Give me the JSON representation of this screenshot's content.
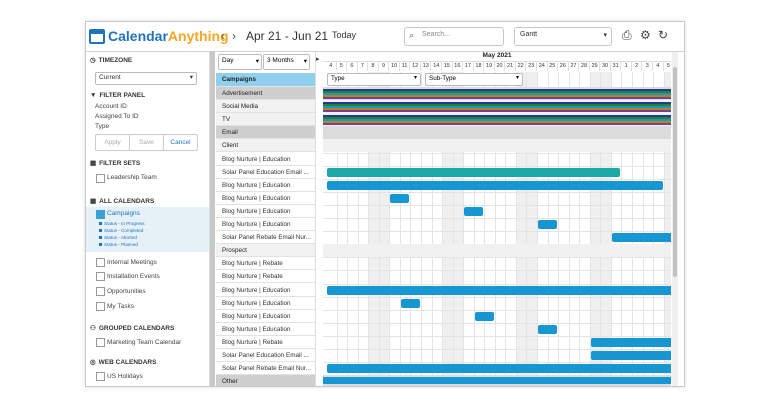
{
  "app": {
    "logo_part1": "Calendar",
    "logo_part2": "Anything"
  },
  "toolbar": {
    "prev": "‹",
    "next": "›",
    "date_range": "Apr 21 - Jun 21",
    "today": "Today",
    "search_placeholder": "Search...",
    "view": "Gantt",
    "print_icon": "printer-icon",
    "settings_icon": "gear-icon",
    "refresh_icon": "refresh-icon"
  },
  "sidebar": {
    "timezone": {
      "title": "TIMEZONE",
      "value": "Current"
    },
    "filter_panel": {
      "title": "FILTER PANEL",
      "fields": [
        "Account ID",
        "Assigned To ID",
        "Type"
      ],
      "apply": "Apply",
      "save": "Save",
      "cancel": "Cancel"
    },
    "filter_sets": {
      "title": "FILTER SETS",
      "items": [
        "Leadership Team"
      ]
    },
    "all_calendars": {
      "title": "ALL CALENDARS",
      "items": [
        "Campaigns",
        "Internal Meetings",
        "Installation Events",
        "Opportunities",
        "My Tasks"
      ],
      "legend": [
        "Status - In Progress",
        "Status - Completed",
        "Status - Aborted",
        "Status - Planned"
      ]
    },
    "grouped_calendars": {
      "title": "GROUPED CALENDARS",
      "items": [
        "Marketing Team Calendar"
      ]
    },
    "web_calendars": {
      "title": "WEB CALENDARS",
      "items": [
        "US Holidays"
      ]
    }
  },
  "gantt": {
    "scale": "Day",
    "span": "3 Months",
    "header": "Campaigns",
    "month": "May 2021",
    "days": [
      "4",
      "5",
      "6",
      "7",
      "8",
      "9",
      "10",
      "11",
      "12",
      "13",
      "14",
      "15",
      "16",
      "17",
      "18",
      "19",
      "20",
      "21",
      "22",
      "23",
      "24",
      "25",
      "26",
      "27",
      "28",
      "29",
      "30",
      "31",
      "1",
      "2",
      "3",
      "4",
      "5"
    ],
    "filter_type": "Type",
    "filter_subtype": "Sub-Type",
    "rows": [
      {
        "label": "Advertisement",
        "kind": "grp"
      },
      {
        "label": "Social Media",
        "kind": "sub"
      },
      {
        "label": "TV",
        "kind": "sub"
      },
      {
        "label": "Email",
        "kind": "grp"
      },
      {
        "label": "Client",
        "kind": "sub"
      },
      {
        "label": "Blog Nurture | Education",
        "kind": "item"
      },
      {
        "label": "Solar Panel Education Email ...",
        "kind": "item"
      },
      {
        "label": "Blog Nurture | Education",
        "kind": "item"
      },
      {
        "label": "Blog Nurture | Education",
        "kind": "item"
      },
      {
        "label": "Blog Nurture | Education",
        "kind": "item"
      },
      {
        "label": "Blog Nurture | Education",
        "kind": "item"
      },
      {
        "label": "Solar Panel Rebate Email Nur...",
        "kind": "item"
      },
      {
        "label": "Prospect",
        "kind": "sub"
      },
      {
        "label": "Blog Nurture | Rebate",
        "kind": "item"
      },
      {
        "label": "Blog Nurture | Rebate",
        "kind": "item"
      },
      {
        "label": "Blog Nurture | Education",
        "kind": "item"
      },
      {
        "label": "Blog Nurture | Education",
        "kind": "item"
      },
      {
        "label": "Blog Nurture | Education",
        "kind": "item"
      },
      {
        "label": "Blog Nurture | Education",
        "kind": "item"
      },
      {
        "label": "Blog Nurture | Rebate",
        "kind": "item"
      },
      {
        "label": "Solar Panel Education Email ...",
        "kind": "item"
      },
      {
        "label": "Solar Panel Rebate Email Nur...",
        "kind": "item"
      },
      {
        "label": "Other",
        "kind": "grp"
      }
    ],
    "bars": [
      {
        "row": 6,
        "start": "4",
        "end": "31",
        "color": "#1ba8a6"
      },
      {
        "row": 7,
        "start": "4",
        "end": "4",
        "color": "#1796d2"
      },
      {
        "row": 8,
        "start": "10",
        "end": "11",
        "color": "#1796d2"
      },
      {
        "row": 9,
        "start": "17",
        "end": "18",
        "color": "#1796d2"
      },
      {
        "row": 10,
        "start": "24",
        "end": "25",
        "color": "#1796d2"
      },
      {
        "row": 11,
        "start": "31",
        "end": "5",
        "color": "#1796d2"
      },
      {
        "row": 15,
        "start": "4",
        "end": "5",
        "color": "#1796d2"
      },
      {
        "row": 16,
        "start": "11",
        "end": "12",
        "color": "#1796d2"
      },
      {
        "row": 17,
        "start": "18",
        "end": "19",
        "color": "#1796d2"
      },
      {
        "row": 18,
        "start": "24",
        "end": "25",
        "color": "#1796d2"
      },
      {
        "row": 19,
        "start": "29",
        "end": "5",
        "color": "#1796d2"
      },
      {
        "row": 20,
        "start": "29",
        "end": "5",
        "color": "#1796d2"
      },
      {
        "row": 21,
        "start": "4",
        "end": "5",
        "color": "#1796d2"
      }
    ],
    "stripe_colors": [
      "#1a3f8f",
      "#2e7d32",
      "#1796d2",
      "#b38b00",
      "#7c3aa3"
    ]
  }
}
